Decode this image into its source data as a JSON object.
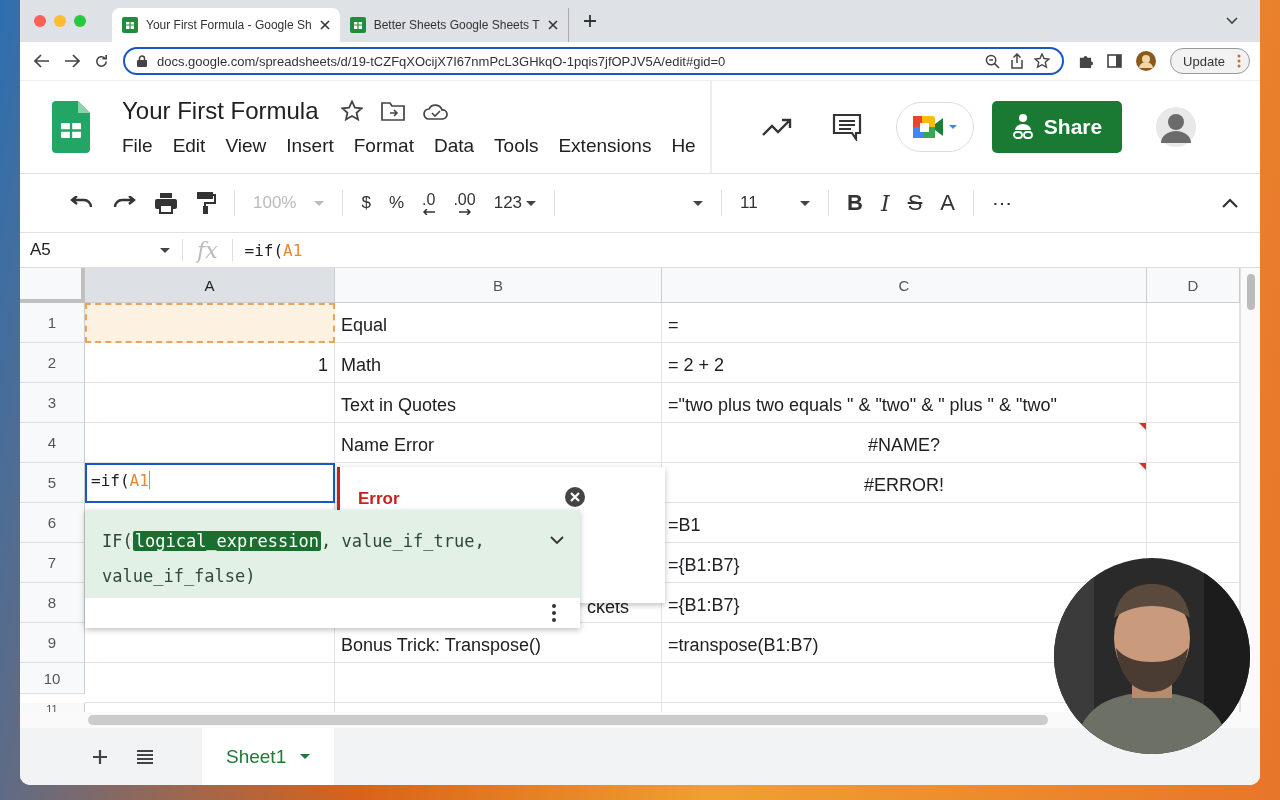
{
  "browser": {
    "tabs": [
      {
        "title": "Your First Formula - Google Sh",
        "selected": true
      },
      {
        "title": "Better Sheets Google Sheets T",
        "selected": false
      }
    ],
    "address": "docs.google.com/spreadsheets/d/19-tCZFqXOcijX7I67nmPcL3GHkqO-1pqis7jfOPJV5A/edit#gid=0",
    "update_button": "Update"
  },
  "document": {
    "title": "Your First Formula",
    "menu": [
      "File",
      "Edit",
      "View",
      "Insert",
      "Format",
      "Data",
      "Tools",
      "Extensions",
      "He"
    ],
    "share_button": "Share"
  },
  "toolbar": {
    "zoom": "100%",
    "currency": "$",
    "percent": "%",
    "decrease_decimals": ".0",
    "increase_decimals": ".00",
    "number_format": "123",
    "font_size": "11",
    "bold": "B",
    "italic": "I",
    "strikethrough": "S",
    "text_color": "A",
    "more": "⋯"
  },
  "formula_bar": {
    "cell_ref": "A5",
    "fx": "fx",
    "formula": "=if(",
    "formula_ref": "A1"
  },
  "grid": {
    "columns": [
      {
        "label": "A",
        "selected": true
      },
      {
        "label": "B",
        "selected": false
      },
      {
        "label": "C",
        "selected": false
      },
      {
        "label": "D",
        "selected": false
      }
    ],
    "rows": [
      {
        "number": "1",
        "a": {
          "referenced": true
        },
        "b": {
          "text": "Equal"
        },
        "c": {
          "text": "="
        }
      },
      {
        "number": "2",
        "a": {
          "text": "1"
        },
        "b": {
          "text": "Math"
        },
        "c": {
          "text": "= 2 + 2"
        }
      },
      {
        "number": "3",
        "b": {
          "text": "Text in Quotes"
        },
        "c": {
          "text": "=\"two plus two equals \" & \"two\" & \" plus \" & \"two\""
        }
      },
      {
        "number": "4",
        "b": {
          "text": "Name Error"
        },
        "c": {
          "text": "#NAME?",
          "error": true
        }
      },
      {
        "number": "5",
        "a": {
          "editor": {
            "text": "=if(",
            "ref": "A1"
          }
        },
        "c": {
          "text": "#ERROR!",
          "error": true
        }
      },
      {
        "number": "6",
        "c": {
          "text": "=B1"
        }
      },
      {
        "number": "7",
        "c": {
          "text": "={B1:B7}"
        }
      },
      {
        "number": "8",
        "b": {
          "text": "ckets",
          "partial": true
        },
        "c": {
          "text": "={B1:B7}"
        }
      },
      {
        "number": "9",
        "b": {
          "text": "Bonus Trick: Transpose()"
        },
        "c": {
          "text": "=transpose(B1:B7)"
        }
      },
      {
        "number": "10"
      },
      {
        "number": "11"
      }
    ]
  },
  "error_card": {
    "title": "Error"
  },
  "formula_hint": {
    "signature": [
      {
        "text": "IF(",
        "active": false
      },
      {
        "text": "logical_expression",
        "active": true
      },
      {
        "text": ", value_if_true, value_if_false)",
        "active": false
      }
    ]
  },
  "sheet_tabs": [
    {
      "label": "Sheet1",
      "selected": true
    }
  ]
}
